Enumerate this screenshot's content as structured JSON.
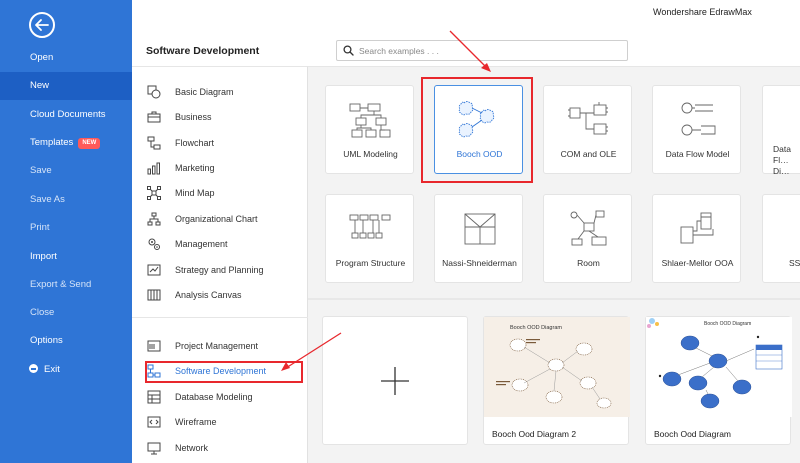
{
  "app": {
    "title": "Wondershare EdrawMax"
  },
  "menu": {
    "items": [
      {
        "label": "Open"
      },
      {
        "label": "New"
      },
      {
        "label": "Cloud Documents"
      },
      {
        "label": "Templates",
        "badge": "NEW"
      },
      {
        "label": "Save"
      },
      {
        "label": "Save As"
      },
      {
        "label": "Print"
      },
      {
        "label": "Import"
      },
      {
        "label": "Export & Send"
      },
      {
        "label": "Close"
      },
      {
        "label": "Options"
      },
      {
        "label": "Exit"
      }
    ]
  },
  "header": {
    "section_title": "Software Development",
    "search_placeholder": "Search examples . . ."
  },
  "categories": [
    {
      "label": "Basic Diagram",
      "icon": "shapes-icon"
    },
    {
      "label": "Business",
      "icon": "briefcase-icon"
    },
    {
      "label": "Flowchart",
      "icon": "flowchart-icon"
    },
    {
      "label": "Marketing",
      "icon": "bar-chart-icon"
    },
    {
      "label": "Mind Map",
      "icon": "mind-map-icon"
    },
    {
      "label": "Organizational Chart",
      "icon": "org-chart-icon"
    },
    {
      "label": "Management",
      "icon": "gears-icon"
    },
    {
      "label": "Strategy and Planning",
      "icon": "strategy-icon"
    },
    {
      "label": "Analysis Canvas",
      "icon": "canvas-icon"
    },
    {
      "label": "Project Management",
      "icon": "project-icon"
    },
    {
      "label": "Software Development",
      "icon": "software-icon"
    },
    {
      "label": "Database Modeling",
      "icon": "database-icon"
    },
    {
      "label": "Wireframe",
      "icon": "wireframe-icon"
    },
    {
      "label": "Network",
      "icon": "network-icon"
    }
  ],
  "templates": [
    {
      "label": "UML Modeling"
    },
    {
      "label": "Booch OOD"
    },
    {
      "label": "COM and OLE"
    },
    {
      "label": "Data Flow Model"
    },
    {
      "label": "Data Fl… Di…"
    },
    {
      "label": "Program Structure"
    },
    {
      "label": "Nassi-Shneiderman"
    },
    {
      "label": "Room"
    },
    {
      "label": "Shlaer-Mellor OOA"
    },
    {
      "label": "SS…"
    }
  ],
  "examples": [
    {
      "label": "Booch Ood Diagram 2",
      "thumb_title": "Booch OOD Diagram"
    },
    {
      "label": "Booch Ood Diagram",
      "thumb_title": "Booch OOD Diagram"
    }
  ],
  "colors": {
    "menu_bg": "#2f75d6",
    "accent": "#2f75d6",
    "highlight_red": "#e8282d"
  }
}
